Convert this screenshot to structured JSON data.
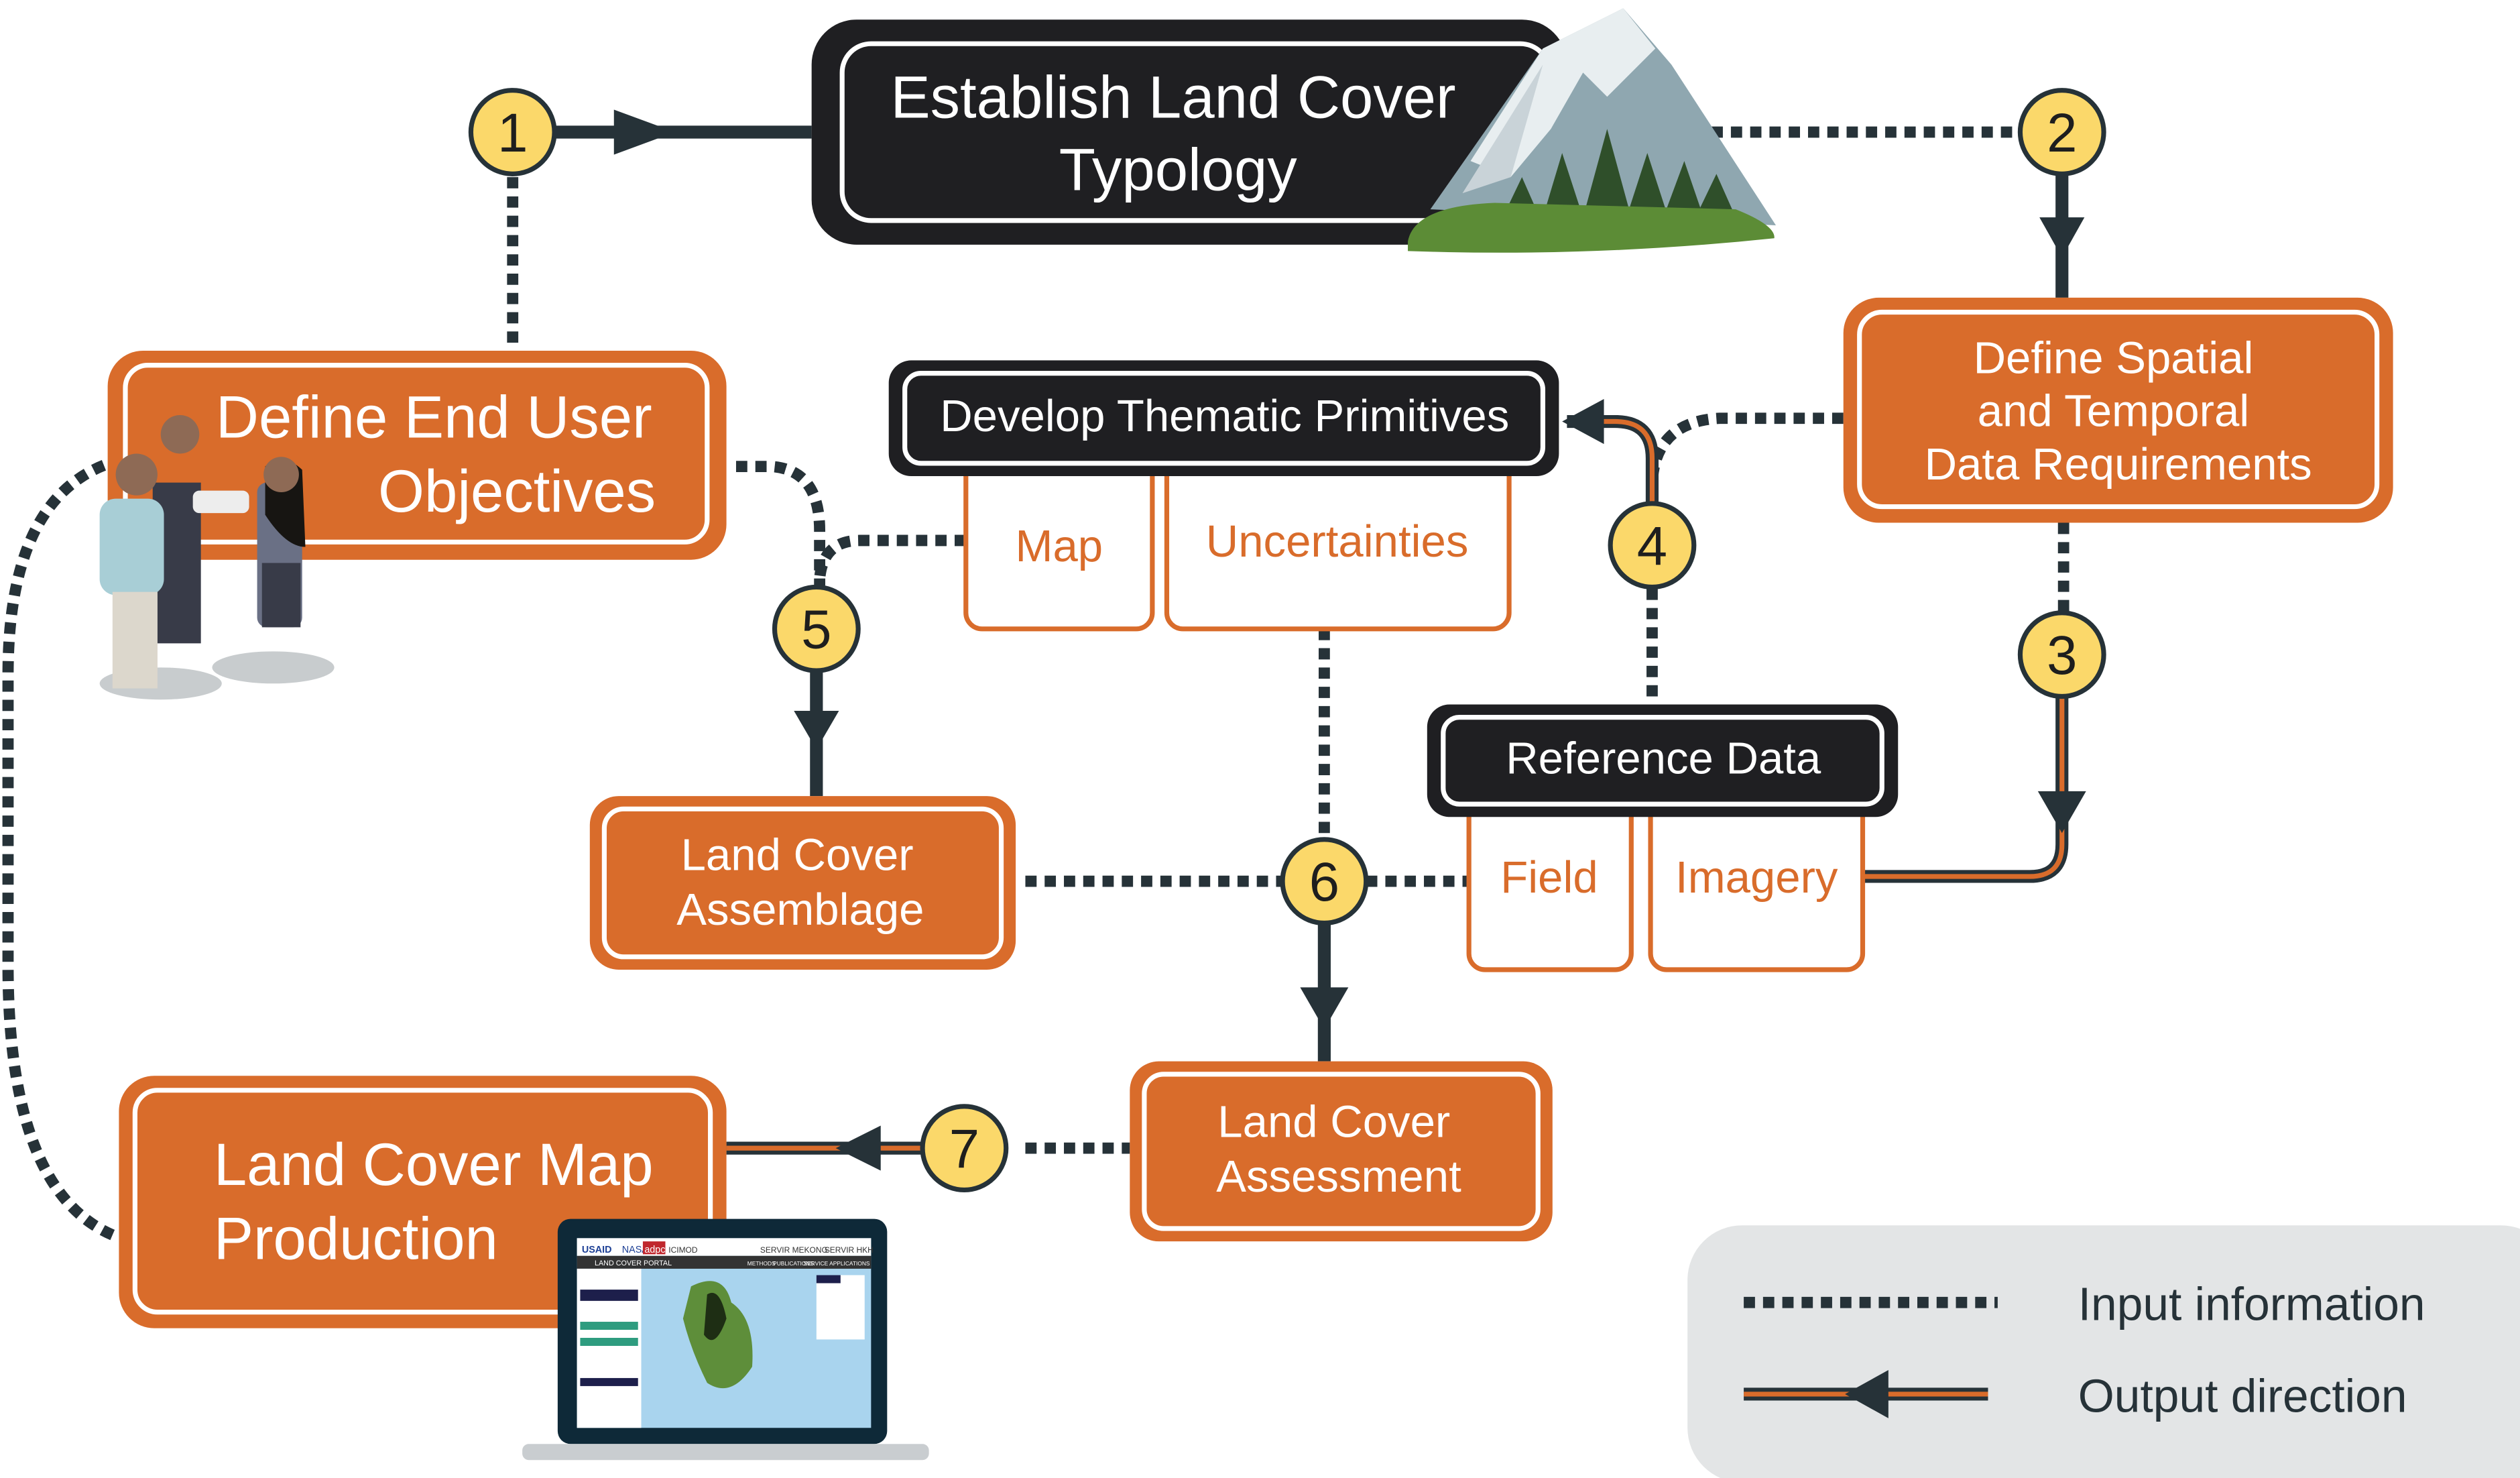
{
  "colors": {
    "orange": "#D96C2B",
    "dark": "#1F1F22",
    "line": "#263238",
    "badge": "#FBD86A",
    "legend_bg": "#E3E5E6"
  },
  "steps": {
    "typology": [
      "Establish Land Cover",
      "Typology"
    ],
    "objectives": [
      "Define End User",
      "Objectives"
    ],
    "spatial": [
      "Define Spatial",
      "and Temporal",
      "Data Requirements"
    ],
    "primitives": "Develop Thematic Primitives",
    "primitives_parts": [
      "Map",
      "Uncertainties"
    ],
    "reference": "Reference Data",
    "reference_parts": [
      "Field",
      "Imagery"
    ],
    "assemblage": [
      "Land Cover",
      "Assemblage"
    ],
    "assessment": [
      "Land Cover",
      "Assessment"
    ],
    "production": [
      "Land Cover Map",
      "Production"
    ]
  },
  "badges": [
    "1",
    "2",
    "3",
    "4",
    "5",
    "6",
    "7"
  ],
  "legend": {
    "input": "Input information",
    "output": "Output direction"
  },
  "laptop_screen": {
    "logos": [
      "USAID",
      "NASA",
      "adpc",
      "ICIMOD",
      "SERVIR MEKONG",
      "SERVIR HKH"
    ],
    "nav_title": "LAND COVER PORTAL",
    "nav_items": [
      "METHODS",
      "PUBLICATIONS",
      "SERVICE APPLICATIONS"
    ]
  }
}
